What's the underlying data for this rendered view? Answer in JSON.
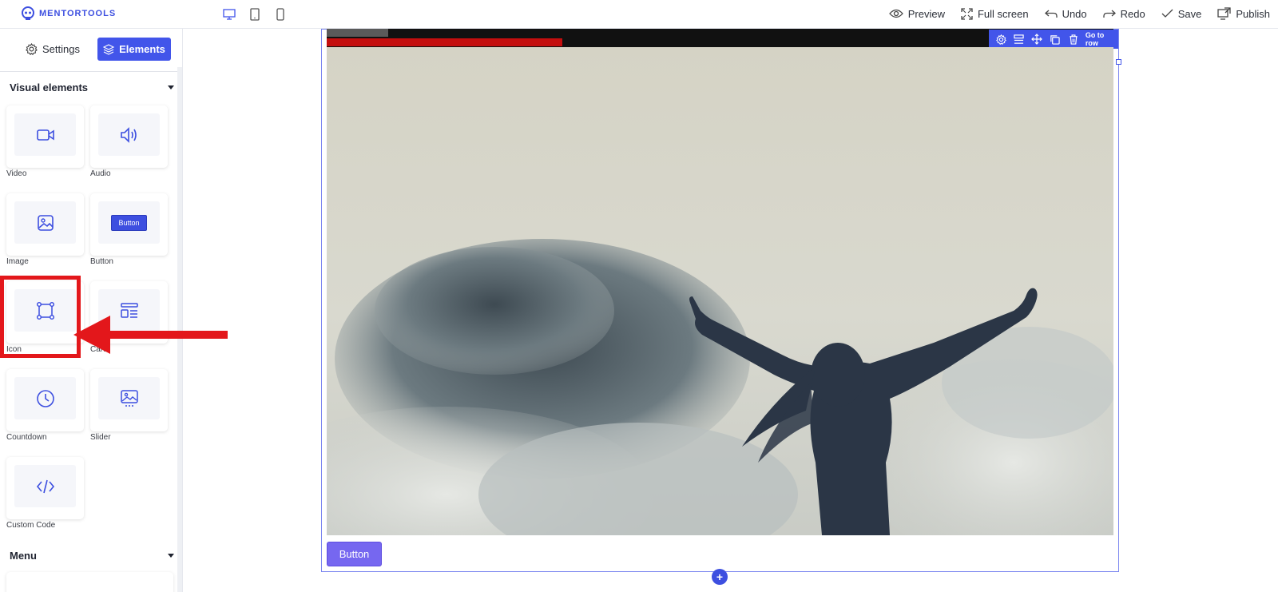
{
  "app": {
    "logo_text": "MENTORTOOLS"
  },
  "header": {
    "devices": [
      {
        "name": "desktop-view-icon"
      },
      {
        "name": "tablet-view-icon"
      },
      {
        "name": "mobile-view-icon"
      }
    ],
    "actions": {
      "preview": "Preview",
      "fullscreen": "Full screen",
      "undo": "Undo",
      "redo": "Redo",
      "save": "Save",
      "publish": "Publish"
    }
  },
  "sidebar": {
    "tabs": {
      "settings": "Settings",
      "elements": "Elements"
    },
    "sections": {
      "visual": "Visual elements",
      "menu": "Menu"
    },
    "tiles": [
      {
        "label": "Video",
        "icon": "video-icon"
      },
      {
        "label": "Audio",
        "icon": "audio-icon"
      },
      {
        "label": "Image",
        "icon": "image-icon"
      },
      {
        "label": "Button",
        "icon": "button-preview",
        "preview_text": "Button"
      },
      {
        "label": "Icon",
        "icon": "icon-element-icon"
      },
      {
        "label": "Card",
        "icon": "card-icon"
      },
      {
        "label": "Countdown",
        "icon": "clock-icon"
      },
      {
        "label": "Slider",
        "icon": "slider-icon"
      },
      {
        "label": "Custom Code",
        "icon": "code-icon"
      }
    ]
  },
  "canvas": {
    "toolbar": {
      "goto_label": "Go to row"
    },
    "button_label": "Button",
    "add_symbol": "+"
  },
  "colors": {
    "accent": "#4255ea",
    "annotation": "#e3171b",
    "button": "#7667f0",
    "progress": "#c40e0e"
  }
}
